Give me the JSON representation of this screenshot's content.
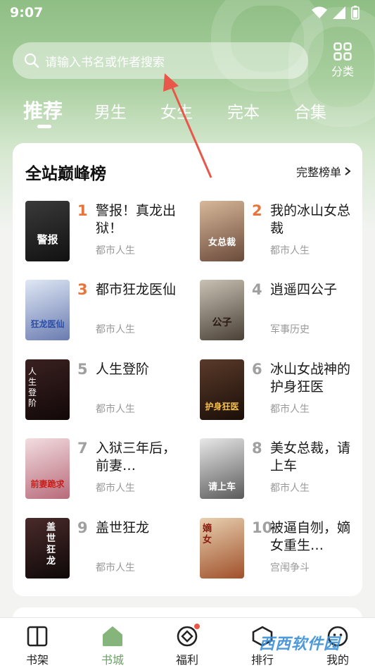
{
  "status_bar": {
    "time": "9:07"
  },
  "search": {
    "placeholder": "请输入书名或作者搜索"
  },
  "category": {
    "label": "分类"
  },
  "tabs": [
    {
      "label": "推荐",
      "active": true
    },
    {
      "label": "男生"
    },
    {
      "label": "女生"
    },
    {
      "label": "完本"
    },
    {
      "label": "合集"
    }
  ],
  "ranking": {
    "title": "全站巅峰榜",
    "more_label": "完整榜单",
    "books": [
      {
        "rank": "1",
        "title": "警报！真龙出狱！",
        "category": "都市人生",
        "cover_text": "警报"
      },
      {
        "rank": "2",
        "title": "我的冰山女总裁",
        "category": "都市人生",
        "cover_text": "女总裁"
      },
      {
        "rank": "3",
        "title": "都市狂龙医仙",
        "category": "都市人生",
        "cover_text": "狂龙医仙"
      },
      {
        "rank": "4",
        "title": "逍遥四公子",
        "category": "军事历史",
        "cover_text": "公子"
      },
      {
        "rank": "5",
        "title": "人生登阶",
        "category": "都市人生",
        "cover_text": "人生登阶"
      },
      {
        "rank": "6",
        "title": "冰山女战神的护身狂医",
        "category": "都市人生",
        "cover_text": "护身狂医"
      },
      {
        "rank": "7",
        "title": "入狱三年后，前妻…",
        "category": "都市人生",
        "cover_text": "前妻跪求"
      },
      {
        "rank": "8",
        "title": "美女总裁，请上车",
        "category": "都市人生",
        "cover_text": "请上车"
      },
      {
        "rank": "9",
        "title": "盖世狂龙",
        "category": "都市人生",
        "cover_text": "盖世狂龙"
      },
      {
        "rank": "10",
        "title": "被逼自刎，嫡女重生…",
        "category": "宫闱争斗",
        "cover_text": "嫡女"
      }
    ]
  },
  "bottom_nav": [
    {
      "label": "书架",
      "icon": "book-icon"
    },
    {
      "label": "书城",
      "icon": "home-icon",
      "active": true
    },
    {
      "label": "福利",
      "icon": "gift-icon"
    },
    {
      "label": "排行",
      "icon": "rank-icon"
    },
    {
      "label": "我的",
      "icon": "profile-icon"
    }
  ],
  "watermark": "西西软件园",
  "colors": {
    "accent": "#6aa263",
    "rank_hot": "#e8743b",
    "arrow": "#e8574a"
  }
}
